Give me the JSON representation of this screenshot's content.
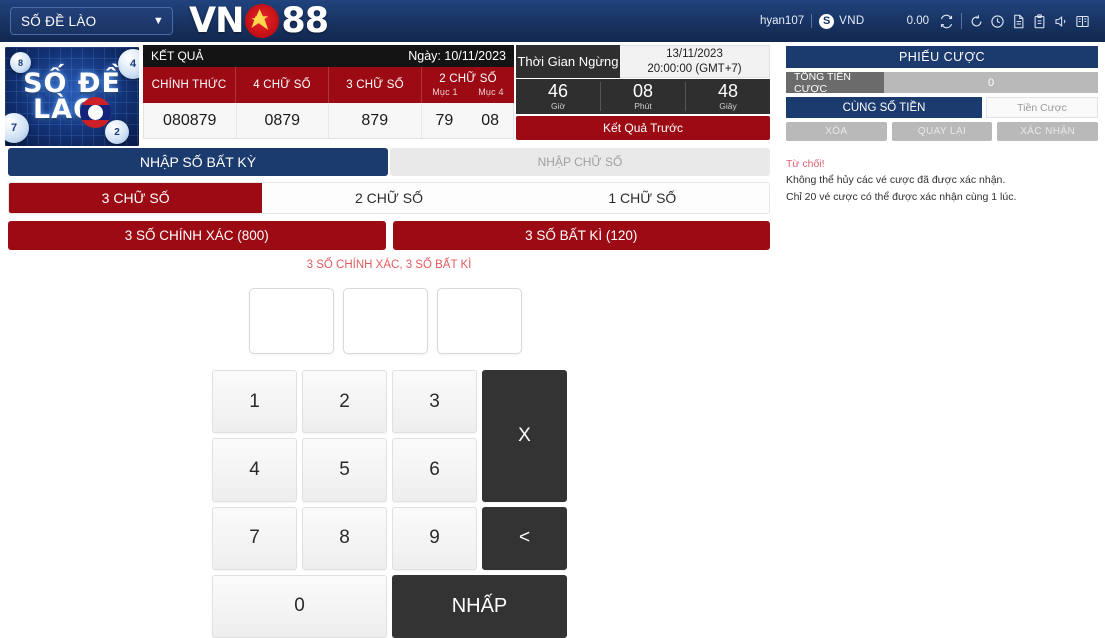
{
  "topbar": {
    "game_selector": "SỐ ĐỀ LÀO",
    "caret": "▼",
    "brand_left": "VN",
    "brand_right": "88",
    "star_icon": "star-icon",
    "user": "hyan107",
    "coin_symbol": "S",
    "currency": "VND",
    "balance": "0.00",
    "icons": [
      "refresh-icon",
      "reload-icon",
      "history-icon",
      "document-icon",
      "clipboard-icon",
      "speaker-icon",
      "book-icon"
    ]
  },
  "banner": {
    "line1": "SỐ ĐỀ",
    "line2": "LÀO",
    "balls": [
      "8",
      "7",
      "4",
      "2"
    ]
  },
  "results": {
    "title": "KẾT QUẢ",
    "date_label": "Ngày: 10/11/2023",
    "columns": [
      "CHÍNH THỨC",
      "4 CHỮ SỐ",
      "3 CHỮ SỐ",
      "2 CHỮ SỐ"
    ],
    "two_digit_sub": [
      "Mục 1",
      "Mục 4"
    ],
    "values": [
      "080879",
      "0879",
      "879"
    ],
    "two_digit_values": [
      "79",
      "08"
    ]
  },
  "timer": {
    "label": "Thời Gian Ngừng",
    "date": "13/11/2023",
    "time": "20:00:00 (GMT+7)",
    "units": [
      {
        "value": "46",
        "name": "Giờ"
      },
      {
        "value": "08",
        "name": "Phút"
      },
      {
        "value": "48",
        "name": "Giây"
      }
    ],
    "prev_result_button": "Kết Quả Trước"
  },
  "tabs": {
    "primary": "NHẬP SỐ BẤT KỲ",
    "secondary": "NHẬP CHỮ SỐ",
    "digit_tabs": [
      {
        "label": "3 CHỮ SỐ",
        "active": true
      },
      {
        "label": "2 CHỮ SỐ",
        "active": false
      },
      {
        "label": "1 CHỮ SỐ",
        "active": false
      }
    ],
    "modes": [
      "3 SỐ CHÍNH XÁC (800)",
      "3 SỐ BẤT KÌ (120)"
    ]
  },
  "subtitle": "3 SỐ CHÍNH XÁC, 3 SỐ BẤT KÌ",
  "inputs": [
    {
      "value": "",
      "placeholder": ""
    },
    {
      "value": "",
      "placeholder": ""
    },
    {
      "value": "",
      "placeholder": ""
    }
  ],
  "keypad": {
    "keys": [
      "1",
      "2",
      "3",
      "4",
      "5",
      "6",
      "7",
      "8",
      "9"
    ],
    "multiply": "X",
    "backspace": "<",
    "zero": "0",
    "submit": "NHẤP"
  },
  "slip": {
    "title": "PHIẾU CƯỢC",
    "total_label": "TỔNG TIỀN CƯỢC",
    "total_value": "0",
    "mode_same": "CÙNG SỐ TIỀN",
    "mode_bet": "Tiền Cược",
    "actions": [
      "XÓA",
      "QUAY LẠI",
      "XÁC NHẬN"
    ],
    "message_title": "Từ chối!",
    "message_line1": "Không thể hủy các vé cược đã được xác nhận.",
    "message_line2": "Chỉ 20 vé cược có thể được xác nhận cùng 1 lúc."
  },
  "colors": {
    "navy": "#1b3a6e",
    "red": "#9c0a14",
    "dark": "#333333",
    "warn": "#e06070"
  }
}
